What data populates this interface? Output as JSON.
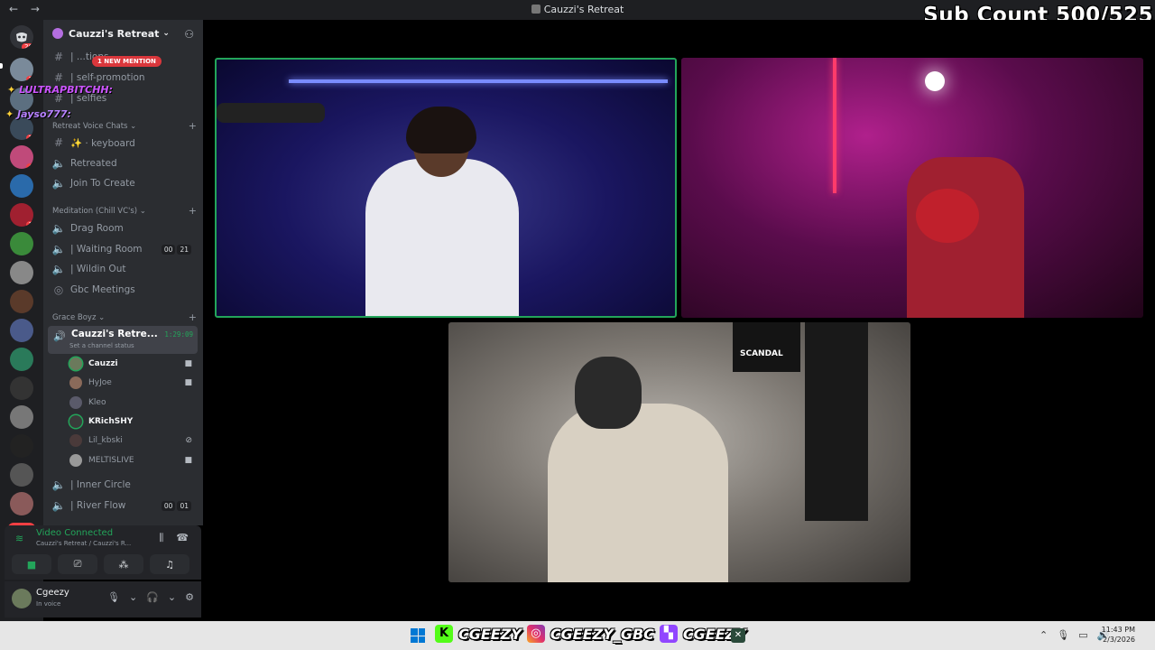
{
  "window": {
    "title": "Cauzzi's Retreat",
    "back": "←",
    "forward": "→"
  },
  "overlay": {
    "sub_count": "Sub Count 500/525"
  },
  "server": {
    "name": "Cauzzi's Retreat",
    "new_mention": "1 NEW MENTION",
    "new_pill": "NEW",
    "badges": [
      "26",
      "1",
      "1",
      "2",
      "4",
      "1"
    ]
  },
  "channels": {
    "top": [
      {
        "label": "| ...tions"
      },
      {
        "label": "| self-promotion"
      },
      {
        "label": "| selfies"
      }
    ],
    "cat_retreat_voice": "Retreat Voice Chats",
    "retreat_voice": [
      {
        "label": "✨ · keyboard"
      },
      {
        "label": "Retreated"
      },
      {
        "label": "Join To Create"
      }
    ],
    "cat_meditation": "Meditation (Chill VC's)",
    "meditation": [
      {
        "label": "Drag Room",
        "counts": []
      },
      {
        "label": "| Waiting Room",
        "counts": [
          "00",
          "21"
        ]
      },
      {
        "label": "| Wildin Out",
        "counts": []
      },
      {
        "label": "Gbc Meetings",
        "counts": []
      }
    ],
    "cat_grace": "Grace Boyz",
    "active_channel": {
      "name": "Cauzzi's Retre...",
      "status": "Set a channel status",
      "time": "1:29:09"
    },
    "users": [
      {
        "name": "Cauzzi",
        "bold": true,
        "cam": true
      },
      {
        "name": "HyJoe",
        "bold": false,
        "cam": true
      },
      {
        "name": "Kleo",
        "bold": false,
        "cam": false
      },
      {
        "name": "KRichSHY",
        "bold": true,
        "cam": false
      },
      {
        "name": "Lil_kbski",
        "bold": false,
        "cam": false
      },
      {
        "name": "MELTISLIVE",
        "bold": false,
        "cam": true
      }
    ],
    "bottom": [
      {
        "label": "| Inner Circle",
        "counts": []
      },
      {
        "label": "| River Flow",
        "counts": [
          "00",
          "01"
        ]
      }
    ]
  },
  "chat_overlay": [
    {
      "user": "LULTRAPBITCHH:"
    },
    {
      "user": "Jayso777:"
    }
  ],
  "voice_panel": {
    "status": "Video Connected",
    "location": "Cauzzi's Retreat / Cauzzi's R..."
  },
  "user_panel": {
    "name": "Cgeezy",
    "status": "In voice"
  },
  "video": {
    "poster_text": "SCANDAL"
  },
  "taskbar": {
    "socials": [
      "CGEEZY",
      "CGEEZY_GBC",
      "CGEEZY"
    ],
    "time": "11:43 PM",
    "date": "2/3/2026"
  },
  "colors": {
    "accent_green": "#23a55a",
    "mention_red": "#da373c",
    "sidebar": "#2b2d31"
  }
}
